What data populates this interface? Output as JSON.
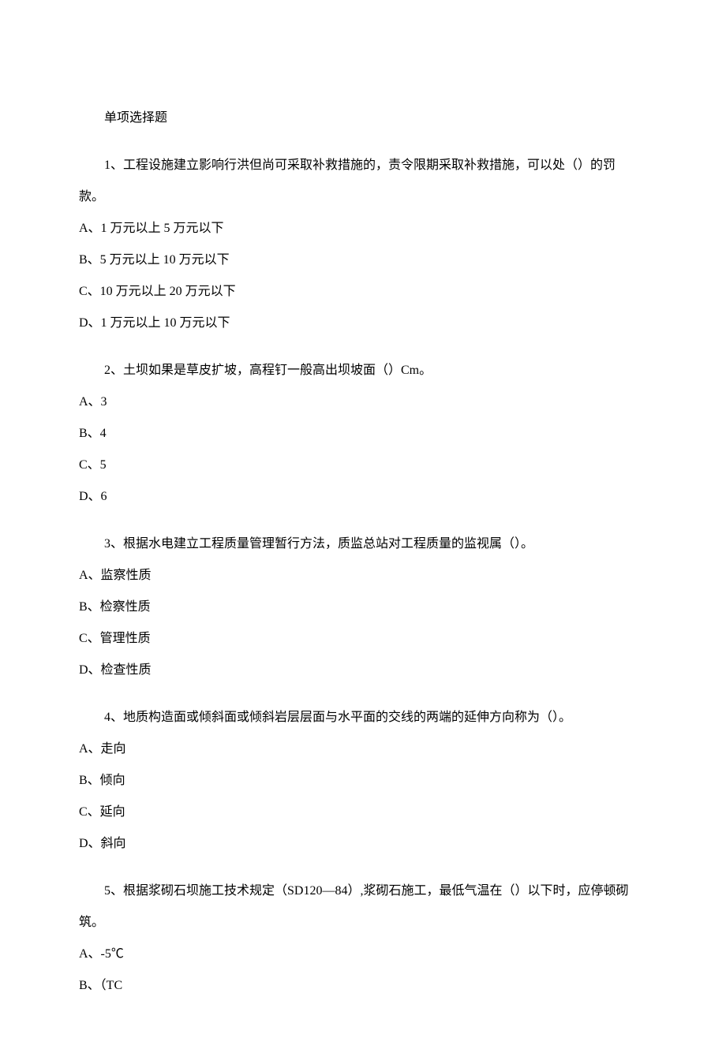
{
  "header": "单项选择题",
  "questions": [
    {
      "id": "q1",
      "text": "1、工程设施建立影响行洪但尚可采取补救措施的，责令限期采取补救措施，可以处（）的罚款。",
      "options": [
        "A、1 万元以上 5 万元以下",
        "B、5 万元以上 10 万元以下",
        "C、10 万元以上 20 万元以下",
        "D、1 万元以上 10 万元以下"
      ]
    },
    {
      "id": "q2",
      "text": "2、土坝如果是草皮扩坡，高程钉一般高出坝坡面（）Cm。",
      "options": [
        "A、3",
        "B、4",
        "C、5",
        "D、6"
      ]
    },
    {
      "id": "q3",
      "text": "3、根据水电建立工程质量管理暂行方法，质监总站对工程质量的监视属（）。",
      "options": [
        "A、监察性质",
        "B、检察性质",
        "C、管理性质",
        "D、检查性质"
      ]
    },
    {
      "id": "q4",
      "text": "4、地质构造面或倾斜面或倾斜岩层层面与水平面的交线的两端的延伸方向称为（）。",
      "options": [
        "A、走向",
        "B、倾向",
        "C、延向",
        "D、斜向"
      ]
    },
    {
      "id": "q5",
      "text": "5、根据浆砌石坝施工技术规定（SD120—84）,浆砌石施工，最低气温在（）以下时，应停顿砌筑。",
      "options": [
        "A、-5℃",
        "B、（TC"
      ]
    }
  ]
}
